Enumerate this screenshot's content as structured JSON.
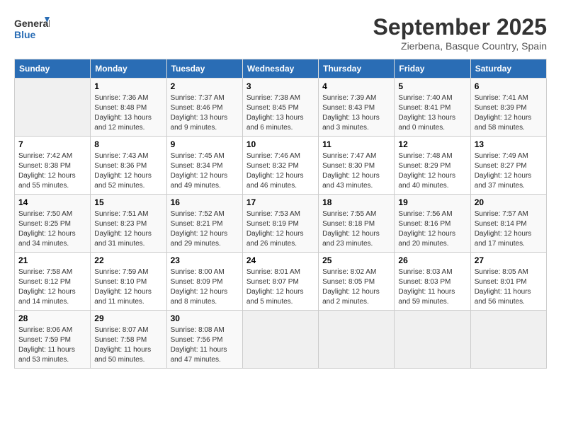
{
  "logo": {
    "line1": "General",
    "line2": "Blue"
  },
  "title": "September 2025",
  "location": "Zierbena, Basque Country, Spain",
  "weekdays": [
    "Sunday",
    "Monday",
    "Tuesday",
    "Wednesday",
    "Thursday",
    "Friday",
    "Saturday"
  ],
  "weeks": [
    [
      {
        "day": "",
        "empty": true
      },
      {
        "day": "1",
        "sunrise": "7:36 AM",
        "sunset": "8:48 PM",
        "daylight": "13 hours and 12 minutes."
      },
      {
        "day": "2",
        "sunrise": "7:37 AM",
        "sunset": "8:46 PM",
        "daylight": "13 hours and 9 minutes."
      },
      {
        "day": "3",
        "sunrise": "7:38 AM",
        "sunset": "8:45 PM",
        "daylight": "13 hours and 6 minutes."
      },
      {
        "day": "4",
        "sunrise": "7:39 AM",
        "sunset": "8:43 PM",
        "daylight": "13 hours and 3 minutes."
      },
      {
        "day": "5",
        "sunrise": "7:40 AM",
        "sunset": "8:41 PM",
        "daylight": "13 hours and 0 minutes."
      },
      {
        "day": "6",
        "sunrise": "7:41 AM",
        "sunset": "8:39 PM",
        "daylight": "12 hours and 58 minutes."
      }
    ],
    [
      {
        "day": "7",
        "sunrise": "7:42 AM",
        "sunset": "8:38 PM",
        "daylight": "12 hours and 55 minutes."
      },
      {
        "day": "8",
        "sunrise": "7:43 AM",
        "sunset": "8:36 PM",
        "daylight": "12 hours and 52 minutes."
      },
      {
        "day": "9",
        "sunrise": "7:45 AM",
        "sunset": "8:34 PM",
        "daylight": "12 hours and 49 minutes."
      },
      {
        "day": "10",
        "sunrise": "7:46 AM",
        "sunset": "8:32 PM",
        "daylight": "12 hours and 46 minutes."
      },
      {
        "day": "11",
        "sunrise": "7:47 AM",
        "sunset": "8:30 PM",
        "daylight": "12 hours and 43 minutes."
      },
      {
        "day": "12",
        "sunrise": "7:48 AM",
        "sunset": "8:29 PM",
        "daylight": "12 hours and 40 minutes."
      },
      {
        "day": "13",
        "sunrise": "7:49 AM",
        "sunset": "8:27 PM",
        "daylight": "12 hours and 37 minutes."
      }
    ],
    [
      {
        "day": "14",
        "sunrise": "7:50 AM",
        "sunset": "8:25 PM",
        "daylight": "12 hours and 34 minutes."
      },
      {
        "day": "15",
        "sunrise": "7:51 AM",
        "sunset": "8:23 PM",
        "daylight": "12 hours and 31 minutes."
      },
      {
        "day": "16",
        "sunrise": "7:52 AM",
        "sunset": "8:21 PM",
        "daylight": "12 hours and 29 minutes."
      },
      {
        "day": "17",
        "sunrise": "7:53 AM",
        "sunset": "8:19 PM",
        "daylight": "12 hours and 26 minutes."
      },
      {
        "day": "18",
        "sunrise": "7:55 AM",
        "sunset": "8:18 PM",
        "daylight": "12 hours and 23 minutes."
      },
      {
        "day": "19",
        "sunrise": "7:56 AM",
        "sunset": "8:16 PM",
        "daylight": "12 hours and 20 minutes."
      },
      {
        "day": "20",
        "sunrise": "7:57 AM",
        "sunset": "8:14 PM",
        "daylight": "12 hours and 17 minutes."
      }
    ],
    [
      {
        "day": "21",
        "sunrise": "7:58 AM",
        "sunset": "8:12 PM",
        "daylight": "12 hours and 14 minutes."
      },
      {
        "day": "22",
        "sunrise": "7:59 AM",
        "sunset": "8:10 PM",
        "daylight": "12 hours and 11 minutes."
      },
      {
        "day": "23",
        "sunrise": "8:00 AM",
        "sunset": "8:09 PM",
        "daylight": "12 hours and 8 minutes."
      },
      {
        "day": "24",
        "sunrise": "8:01 AM",
        "sunset": "8:07 PM",
        "daylight": "12 hours and 5 minutes."
      },
      {
        "day": "25",
        "sunrise": "8:02 AM",
        "sunset": "8:05 PM",
        "daylight": "12 hours and 2 minutes."
      },
      {
        "day": "26",
        "sunrise": "8:03 AM",
        "sunset": "8:03 PM",
        "daylight": "11 hours and 59 minutes."
      },
      {
        "day": "27",
        "sunrise": "8:05 AM",
        "sunset": "8:01 PM",
        "daylight": "11 hours and 56 minutes."
      }
    ],
    [
      {
        "day": "28",
        "sunrise": "8:06 AM",
        "sunset": "7:59 PM",
        "daylight": "11 hours and 53 minutes."
      },
      {
        "day": "29",
        "sunrise": "8:07 AM",
        "sunset": "7:58 PM",
        "daylight": "11 hours and 50 minutes."
      },
      {
        "day": "30",
        "sunrise": "8:08 AM",
        "sunset": "7:56 PM",
        "daylight": "11 hours and 47 minutes."
      },
      {
        "day": "",
        "empty": true
      },
      {
        "day": "",
        "empty": true
      },
      {
        "day": "",
        "empty": true
      },
      {
        "day": "",
        "empty": true
      }
    ]
  ]
}
